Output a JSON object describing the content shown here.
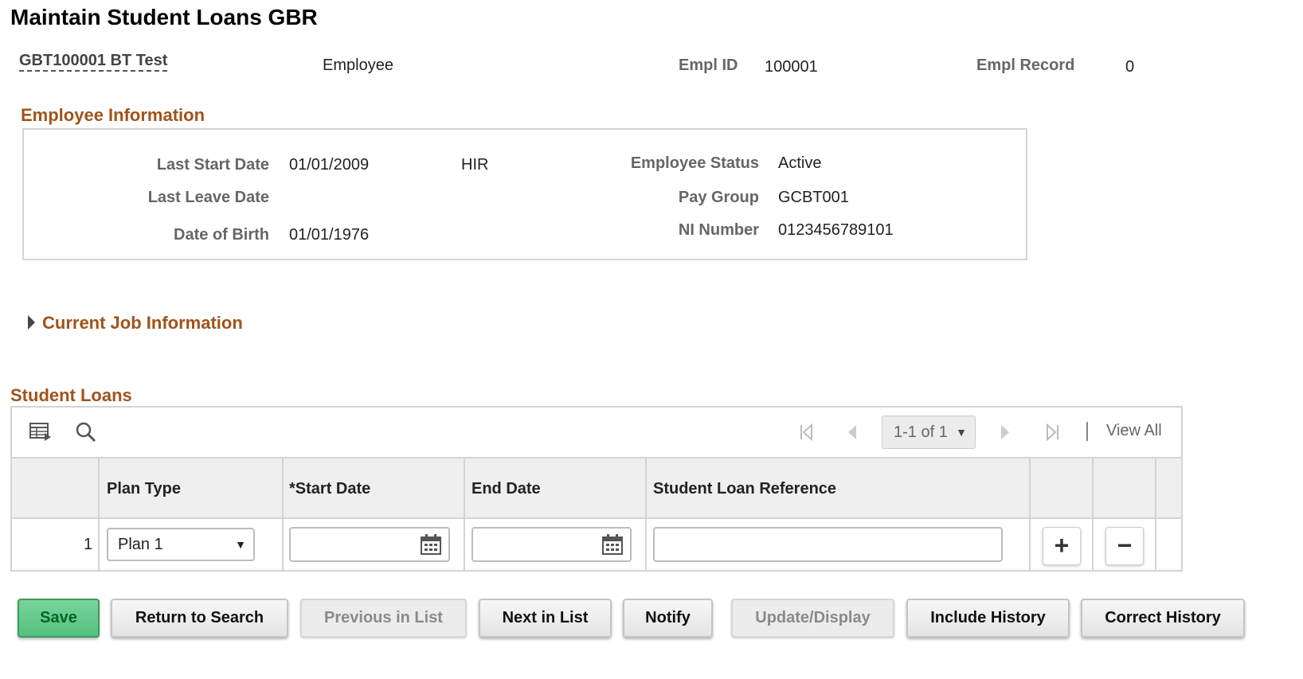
{
  "page_title": "Maintain Student Loans GBR",
  "header": {
    "employee_name": "GBT100001 BT Test",
    "employee_type": "Employee",
    "empl_id_label": "Empl ID",
    "empl_id_value": "100001",
    "empl_record_label": "Empl Record",
    "empl_record_value": "0"
  },
  "employee_info": {
    "title": "Employee Information",
    "last_start_date_label": "Last Start Date",
    "last_start_date_value": "01/01/2009",
    "last_start_action": "HIR",
    "last_leave_date_label": "Last Leave Date",
    "last_leave_date_value": "",
    "dob_label": "Date of Birth",
    "dob_value": "01/01/1976",
    "status_label": "Employee Status",
    "status_value": "Active",
    "pay_group_label": "Pay Group",
    "pay_group_value": "GCBT001",
    "ni_label": "NI Number",
    "ni_value": "0123456789101"
  },
  "current_job": {
    "title": "Current Job Information",
    "expanded": false
  },
  "student_loans": {
    "title": "Student Loans",
    "pager": {
      "range": "1-1 of 1",
      "view_all": "View All"
    },
    "columns": [
      "Plan Type",
      "*Start Date",
      "End Date",
      "Student Loan Reference"
    ],
    "rows": [
      {
        "num": "1",
        "plan_type": "Plan 1",
        "start_date": "",
        "end_date": "",
        "reference": ""
      }
    ]
  },
  "buttons": {
    "save": "Save",
    "return_to_search": "Return to Search",
    "previous_in_list": "Previous in List",
    "next_in_list": "Next in List",
    "notify": "Notify",
    "update_display": "Update/Display",
    "include_history": "Include History",
    "correct_history": "Correct History"
  },
  "colors": {
    "section_title": "#a0531a",
    "primary_button": "#55c07e",
    "border": "#d4d4d4"
  }
}
